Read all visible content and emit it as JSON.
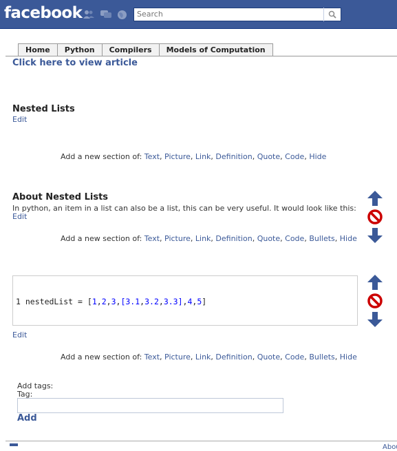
{
  "header": {
    "logo": "facebook",
    "search": {
      "placeholder": "Search"
    }
  },
  "tabs": [
    "Home",
    "Python",
    "Compilers",
    "Models of Computation"
  ],
  "view_article": "Click here to view article",
  "sections": [
    {
      "title": "Nested Lists",
      "edit": "Edit"
    },
    {
      "title": "About Nested Lists",
      "text": "In python, an item in a list can also be a list, this can be very useful. It would look like this:",
      "edit": "Edit"
    },
    {
      "edit": "Edit"
    }
  ],
  "add_section": {
    "prefix": "Add a new section of:",
    "options_first": [
      "Text",
      "Picture",
      "Link",
      "Definition",
      "Quote",
      "Code",
      "Hide"
    ],
    "options_full": [
      "Text",
      "Picture",
      "Link",
      "Definition",
      "Quote",
      "Code",
      "Bullets",
      "Hide"
    ]
  },
  "code": {
    "line_number": "1",
    "identifier": "nestedList",
    "operator": " = [",
    "tokens": [
      "1",
      "2",
      "3",
      "[3.1",
      "3.2",
      "3.3]",
      "4",
      "5"
    ],
    "closing": "]"
  },
  "tags": {
    "add_tags": "Add tags:",
    "tag_label": "Tag:",
    "add_button": "Add"
  },
  "footer": {
    "about": "Abou"
  },
  "colors": {
    "brand": "#3b5998",
    "up_down_arrow": "#3b5998",
    "delete": "#cc0000"
  }
}
